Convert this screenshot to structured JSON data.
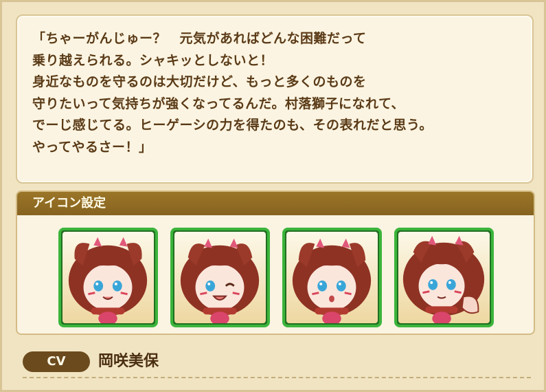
{
  "quote": {
    "lines": [
      "「ちゃーがんじゅー？　元気があればどんな困難だって",
      "乗り越えられる。シャキッとしないと！",
      "身近なものを守るのは大切だけど、もっと多くのものを",
      "守りたいって気持ちが強くなってるんだ。村落獅子になれて、",
      "でーじ感じてる。ヒーゲーシの力を得たのも、その表れだと思う。",
      "やってやるさー！」"
    ]
  },
  "icon_settings": {
    "header": "アイコン設定",
    "icons": [
      {
        "icon": "character-icon-smile"
      },
      {
        "icon": "character-icon-wink"
      },
      {
        "icon": "character-icon-surprised"
      },
      {
        "icon": "character-icon-pose"
      }
    ]
  },
  "cv": {
    "badge": "CV",
    "name": "岡咲美保"
  },
  "colors": {
    "header_bg": "#8f6b23",
    "icon_border": "#3cb43c",
    "text": "#5a3a16"
  }
}
